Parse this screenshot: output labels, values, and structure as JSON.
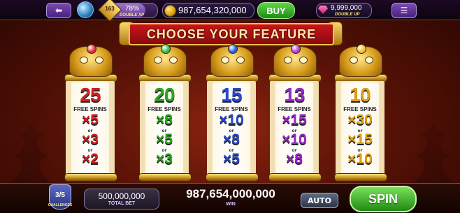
{
  "header": {
    "back_icon": "arrow-left-icon",
    "globe_icon": "globe-icon",
    "level": "163",
    "xp_percent": "78%",
    "xp_badge": "DOUBLE XP",
    "coin_balance": "987,654,320,000",
    "buy_label": "BUY",
    "gem_balance": "9,999,000",
    "gem_badge": "DOUBLE UP",
    "menu_icon": "hamburger-icon"
  },
  "banner": {
    "title": "CHOOSE YOUR FEATURE"
  },
  "features": [
    {
      "spins": "25",
      "label": "FREE SPINS",
      "multipliers": [
        "×5",
        "×3",
        "×2"
      ],
      "color": "#d42020",
      "gem_color": "#e03040"
    },
    {
      "spins": "20",
      "label": "FREE SPINS",
      "multipliers": [
        "×8",
        "×5",
        "×3"
      ],
      "color": "#2aa81a",
      "gem_color": "#30c050"
    },
    {
      "spins": "15",
      "label": "FREE SPINS",
      "multipliers": [
        "×10",
        "×8",
        "×5"
      ],
      "color": "#2a4ad0",
      "gem_color": "#3060e0"
    },
    {
      "spins": "13",
      "label": "FREE SPINS",
      "multipliers": [
        "×15",
        "×10",
        "×8"
      ],
      "color": "#9a28c8",
      "gem_color": "#b040e0"
    },
    {
      "spins": "10",
      "label": "FREE SPINS",
      "multipliers": [
        "×30",
        "×15",
        "×10"
      ],
      "color": "#e0a010",
      "gem_color": "#f0c030"
    }
  ],
  "or_label": "or",
  "footer": {
    "challenges_progress": "3/5",
    "challenges_label": "CHALLENGES",
    "total_bet_value": "500,000,000",
    "total_bet_label": "TOTAL BET",
    "win_value": "987,654,000,000",
    "win_label": "WIN",
    "auto_label": "AUTO",
    "spin_label": "SPIN"
  }
}
